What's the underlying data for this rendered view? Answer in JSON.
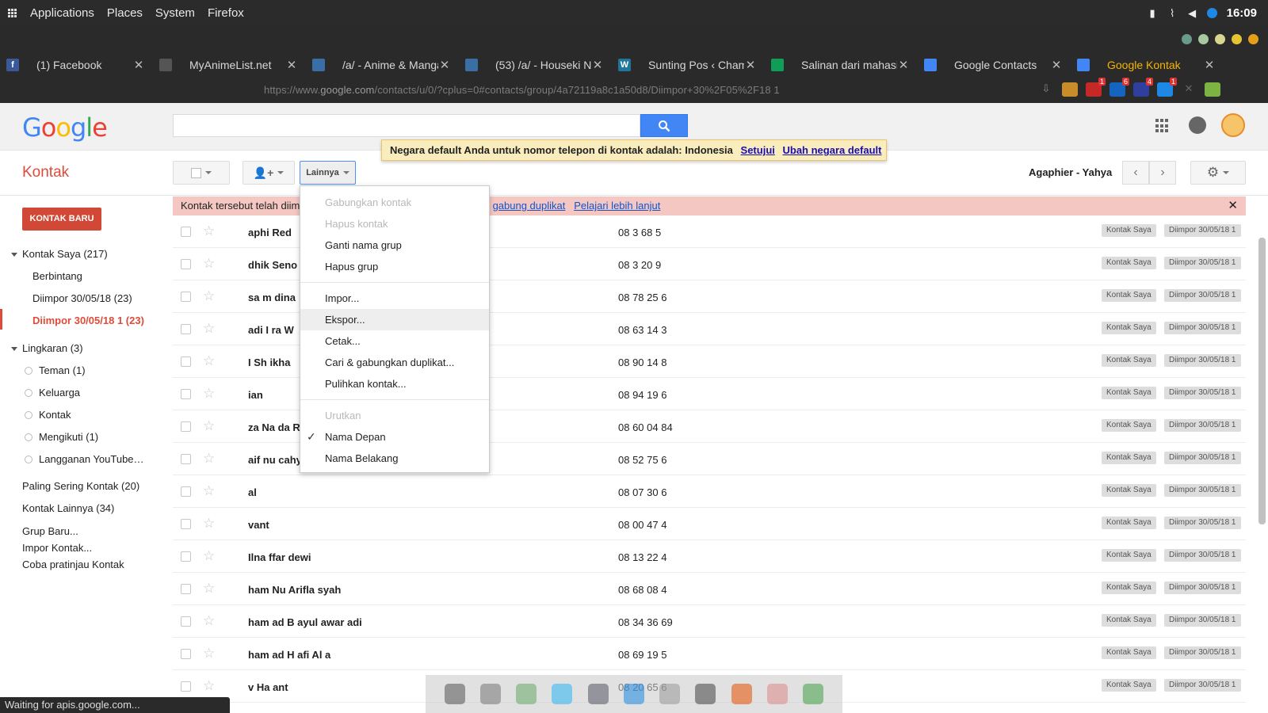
{
  "os": {
    "menu": [
      "Applications",
      "Places",
      "System",
      "Firefox"
    ],
    "clock": "16:09"
  },
  "browser": {
    "tabs": [
      {
        "title": "(1) Facebook",
        "icon": "facebook-icon",
        "color": "#3b5998",
        "glyph": "f"
      },
      {
        "title": "MyAnimeList.net",
        "icon": "globe-icon",
        "color": "#555555",
        "glyph": ""
      },
      {
        "title": "/a/ - Anime & Manga -",
        "icon": "clover-icon",
        "color": "#3a6ea5",
        "glyph": ""
      },
      {
        "title": "(53) /a/ - Houseki No K",
        "icon": "clover-icon",
        "color": "#3a6ea5",
        "glyph": ""
      },
      {
        "title": "Sunting Pos ‹ Chamele",
        "icon": "wordpress-icon",
        "color": "#21759b",
        "glyph": "W"
      },
      {
        "title": "Salinan dari mahasisw",
        "icon": "sheets-icon",
        "color": "#0f9d58",
        "glyph": ""
      },
      {
        "title": "Google Contacts",
        "icon": "contacts-icon",
        "color": "#4285f4",
        "glyph": ""
      },
      {
        "title": "Google Kontak",
        "icon": "contacts-icon",
        "color": "#4285f4",
        "glyph": ""
      }
    ],
    "url_prefix": "https://www.",
    "url_domain": "google.com",
    "url_rest": "/contacts/u/0/?cplus=0#contacts/group/4a72119a8c1a50d8/Diimpor+30%2F05%2F18 1",
    "status": "Waiting for apis.google.com..."
  },
  "header": {
    "logo": "Google",
    "notice_text": "Negara default Anda untuk nomor telepon di kontak adalah: Indonesia",
    "notice_agree": "Setujui",
    "notice_change": "Ubah negara default"
  },
  "app": {
    "title": "Kontak",
    "new_contact": "KONTAK BARU",
    "more_label": "Lainnya",
    "account": "Agaphier - Yahya"
  },
  "nav": {
    "my_contacts": "Kontak Saya (217)",
    "starred": "Berbintang",
    "imported1": "Diimpor 30/05/18 (23)",
    "imported2": "Diimpor 30/05/18 1 (23)",
    "circles": "Lingkaran (3)",
    "friends": "Teman (1)",
    "family": "Keluarga",
    "contacts": "Kontak",
    "following": "Mengikuti (1)",
    "youtube": "Langganan YouTube…",
    "frequent": "Paling Sering Kontak (20)",
    "others": "Kontak Lainnya (34)",
    "new_group": "Grup Baru...",
    "import": "Impor Kontak...",
    "preview": "Coba pratinjau Kontak"
  },
  "banner": {
    "text": "Kontak tersebut telah diim",
    "link1": "gabung duplikat",
    "link2": "Pelajari lebih lanjut"
  },
  "menu": {
    "merge": "Gabungkan kontak",
    "delete": "Hapus kontak",
    "rename": "Ganti nama grup",
    "delete_group": "Hapus grup",
    "import": "Impor...",
    "export": "Ekspor...",
    "print": "Cetak...",
    "find_dupes": "Cari & gabungkan duplikat...",
    "restore": "Pulihkan kontak...",
    "sort_header": "Urutkan",
    "first_name": "Nama Depan",
    "last_name": "Nama Belakang"
  },
  "rows": [
    {
      "name": "aphi   Red",
      "phone": "08   3   68   5"
    },
    {
      "name": "dhik   Seno",
      "phone": "08   3   20   9"
    },
    {
      "name": "sa m   dina",
      "phone": "08   78   25   6"
    },
    {
      "name": "adi I   ra W",
      "phone": "08   63   14   3"
    },
    {
      "name": "I Sh   ikha",
      "phone": "08   90   14   8"
    },
    {
      "name": "ian",
      "phone": "08   94   19   6"
    },
    {
      "name": "za Na   da R",
      "phone": "08   60   04   84"
    },
    {
      "name": "aif nu   cahy",
      "phone": "08   52   75   6"
    },
    {
      "name": "al",
      "phone": "08   07   30   6"
    },
    {
      "name": "vant",
      "phone": "08   00   47   4"
    },
    {
      "name": "Ilna   ffar   dewi",
      "phone": "08   13   22   4"
    },
    {
      "name": "ham   Nu   Arifla   syah",
      "phone": "08   68   08   4"
    },
    {
      "name": "ham   ad B   ayul   awar   adi",
      "phone": "08   34   36   69"
    },
    {
      "name": "ham   ad H   afi Al   a",
      "phone": "08   69   19   5"
    },
    {
      "name": "v Ha   ant",
      "phone": "08   20   65   6"
    }
  ],
  "tags": {
    "tag1": "Kontak Saya",
    "tag2": "Diimpor 30/05/18 1"
  }
}
